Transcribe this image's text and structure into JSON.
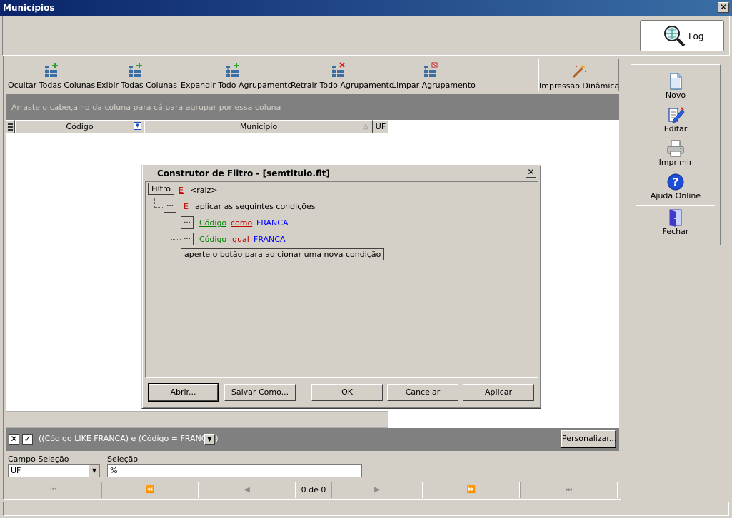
{
  "window": {
    "title": "Municípios",
    "close": "✕"
  },
  "log_button": {
    "label": "Log"
  },
  "toolbar": {
    "items": [
      {
        "label": "Ocultar Todas Colunas",
        "icon": "hide-columns-icon"
      },
      {
        "label": "Exibir Todas  Colunas",
        "icon": "show-columns-icon"
      },
      {
        "label": "Expandir Todo Agrupamento",
        "icon": "expand-grouping-icon"
      },
      {
        "label": "Retrair Todo Agrupamento",
        "icon": "collapse-grouping-icon"
      },
      {
        "label": "Limpar Agrupamento",
        "icon": "clear-grouping-icon"
      }
    ],
    "dynamic_print": {
      "label": "Impressão Dinâmica",
      "icon": "magic-wand-icon"
    }
  },
  "grid": {
    "group_hint": "Arraste o cabeçalho da coluna para cá para agrupar por essa coluna",
    "columns": [
      "Código",
      "Município",
      "UF"
    ]
  },
  "filter_bar": {
    "text": "((Código LIKE FRANCA) e (Código = FRANCA))",
    "customize": "Personalizar..."
  },
  "selection": {
    "field_label": "Campo Seleção",
    "field_value": "UF",
    "selection_label": "Seleção",
    "selection_value": "%"
  },
  "navigator": {
    "count": "0 de 0"
  },
  "side_menu": {
    "items": [
      {
        "label": "Novo",
        "icon": "new-document-icon",
        "color": "#3a6ea5"
      },
      {
        "label": "Editar",
        "icon": "edit-icon",
        "color": "#1e40af"
      },
      {
        "label": "Imprimir",
        "icon": "printer-icon",
        "color": "#6b7280"
      },
      {
        "label": "Ajuda Online",
        "icon": "help-icon",
        "color": "#1d4ed8"
      },
      {
        "label": "Fechar",
        "icon": "exit-door-icon",
        "color": "#4338ca"
      }
    ]
  },
  "dialog": {
    "title": "Construtor de Filtro - [semtitulo.flt]",
    "close": "✕",
    "root_tab": "Filtro",
    "root_op": "E",
    "root_label": "<raiz>",
    "group_op": "E",
    "group_label": "aplicar as seguintes condições",
    "conditions": [
      {
        "field": "Código",
        "operator": "como",
        "value": "FRANCA"
      },
      {
        "field": "Código",
        "operator": "igual",
        "value": "FRANCA"
      }
    ],
    "add_hint": "aperte o botão para adicionar uma nova condição",
    "buttons": {
      "open": "Abrir...",
      "save_as": "Salvar Como...",
      "ok": "OK",
      "cancel": "Cancelar",
      "apply": "Aplicar"
    }
  }
}
